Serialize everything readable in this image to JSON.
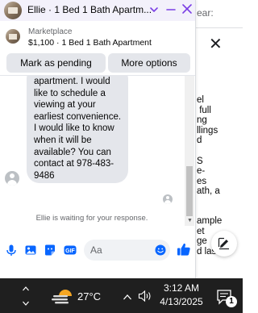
{
  "background_page": {
    "header_fragment": "ear:",
    "close_glyph": "✕",
    "body_fragments": "el\n full\nng\nllings\nd\n\nS\ne-\nes\nath, a\n\n",
    "body_fragments_lower": "ample\net\nge\nd las"
  },
  "chat": {
    "title": "Ellie · 1 Bed 1 Bath Apartm...",
    "listing": {
      "kicker": "Marketplace",
      "subtitle": "$1,100 · 1 Bed 1 Bath Apartment"
    },
    "buttons": {
      "pending": "Mark as pending",
      "more": "More options"
    },
    "message": "apartment.  I would like to schedule a viewing at your earliest convenience. I would like to know when it will be available? You can contact at 978-483-9486",
    "waiting": "Ellie is waiting for your response.",
    "composer": {
      "placeholder": "Aa"
    },
    "icons": {
      "header": [
        "thumbnail",
        "chevron-down-icon",
        "minimize-icon",
        "close-icon"
      ],
      "composer": [
        "microphone-icon",
        "photo-icon",
        "sticker-icon",
        "gif-icon",
        "emoji-icon",
        "like-icon"
      ]
    },
    "colors": {
      "accent": "#0866ff",
      "header_close": "#7b3fe4",
      "bubble": "#e4e6eb"
    }
  },
  "taskbar": {
    "temperature": "27°C",
    "time": "3:12 AM",
    "date": "4/13/2025",
    "notification_count": "1"
  }
}
